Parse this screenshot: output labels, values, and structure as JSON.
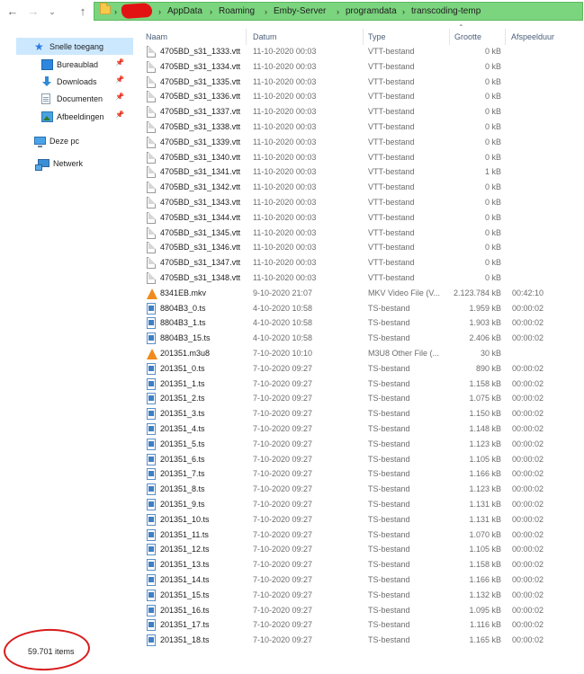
{
  "navigation": {
    "back_icon": "arrow-left",
    "forward_icon": "arrow-right",
    "recent_icon": "chevron-down",
    "up_icon": "arrow-up"
  },
  "address_bar": {
    "highlight_color": "#7bd47e",
    "redaction_color": "#e31212",
    "breadcrumbs": [
      "AppData",
      "Roaming",
      "Emby-Server",
      "programdata",
      "transcoding-temp"
    ]
  },
  "sidebar": {
    "quick_access": "Snelle toegang",
    "items": [
      {
        "label": "Bureaublad",
        "icon": "desktop-icon"
      },
      {
        "label": "Downloads",
        "icon": "download-icon"
      },
      {
        "label": "Documenten",
        "icon": "documents-icon"
      },
      {
        "label": "Afbeeldingen",
        "icon": "pictures-icon"
      }
    ],
    "this_pc": "Deze pc",
    "network": "Netwerk"
  },
  "columns": {
    "name": "Naam",
    "date": "Datum",
    "type": "Type",
    "size": "Grootte",
    "duration": "Afspeelduur"
  },
  "files": [
    {
      "name": "4705BD_s31_1333.vtt",
      "date": "11-10-2020 00:03",
      "type": "VTT-bestand",
      "size": "0 kB",
      "duration": "",
      "icon": "vtt"
    },
    {
      "name": "4705BD_s31_1334.vtt",
      "date": "11-10-2020 00:03",
      "type": "VTT-bestand",
      "size": "0 kB",
      "duration": "",
      "icon": "vtt"
    },
    {
      "name": "4705BD_s31_1335.vtt",
      "date": "11-10-2020 00:03",
      "type": "VTT-bestand",
      "size": "0 kB",
      "duration": "",
      "icon": "vtt"
    },
    {
      "name": "4705BD_s31_1336.vtt",
      "date": "11-10-2020 00:03",
      "type": "VTT-bestand",
      "size": "0 kB",
      "duration": "",
      "icon": "vtt"
    },
    {
      "name": "4705BD_s31_1337.vtt",
      "date": "11-10-2020 00:03",
      "type": "VTT-bestand",
      "size": "0 kB",
      "duration": "",
      "icon": "vtt"
    },
    {
      "name": "4705BD_s31_1338.vtt",
      "date": "11-10-2020 00:03",
      "type": "VTT-bestand",
      "size": "0 kB",
      "duration": "",
      "icon": "vtt"
    },
    {
      "name": "4705BD_s31_1339.vtt",
      "date": "11-10-2020 00:03",
      "type": "VTT-bestand",
      "size": "0 kB",
      "duration": "",
      "icon": "vtt"
    },
    {
      "name": "4705BD_s31_1340.vtt",
      "date": "11-10-2020 00:03",
      "type": "VTT-bestand",
      "size": "0 kB",
      "duration": "",
      "icon": "vtt"
    },
    {
      "name": "4705BD_s31_1341.vtt",
      "date": "11-10-2020 00:03",
      "type": "VTT-bestand",
      "size": "1 kB",
      "duration": "",
      "icon": "vtt"
    },
    {
      "name": "4705BD_s31_1342.vtt",
      "date": "11-10-2020 00:03",
      "type": "VTT-bestand",
      "size": "0 kB",
      "duration": "",
      "icon": "vtt"
    },
    {
      "name": "4705BD_s31_1343.vtt",
      "date": "11-10-2020 00:03",
      "type": "VTT-bestand",
      "size": "0 kB",
      "duration": "",
      "icon": "vtt"
    },
    {
      "name": "4705BD_s31_1344.vtt",
      "date": "11-10-2020 00:03",
      "type": "VTT-bestand",
      "size": "0 kB",
      "duration": "",
      "icon": "vtt"
    },
    {
      "name": "4705BD_s31_1345.vtt",
      "date": "11-10-2020 00:03",
      "type": "VTT-bestand",
      "size": "0 kB",
      "duration": "",
      "icon": "vtt"
    },
    {
      "name": "4705BD_s31_1346.vtt",
      "date": "11-10-2020 00:03",
      "type": "VTT-bestand",
      "size": "0 kB",
      "duration": "",
      "icon": "vtt"
    },
    {
      "name": "4705BD_s31_1347.vtt",
      "date": "11-10-2020 00:03",
      "type": "VTT-bestand",
      "size": "0 kB",
      "duration": "",
      "icon": "vtt"
    },
    {
      "name": "4705BD_s31_1348.vtt",
      "date": "11-10-2020 00:03",
      "type": "VTT-bestand",
      "size": "0 kB",
      "duration": "",
      "icon": "vtt"
    },
    {
      "name": "8341EB.mkv",
      "date": "9-10-2020 21:07",
      "type": "MKV Video File (V...",
      "size": "2.123.784 kB",
      "duration": "00:42:10",
      "icon": "vlc"
    },
    {
      "name": "8804B3_0.ts",
      "date": "4-10-2020 10:58",
      "type": "TS-bestand",
      "size": "1.959 kB",
      "duration": "00:00:02",
      "icon": "ts"
    },
    {
      "name": "8804B3_1.ts",
      "date": "4-10-2020 10:58",
      "type": "TS-bestand",
      "size": "1.903 kB",
      "duration": "00:00:02",
      "icon": "ts"
    },
    {
      "name": "8804B3_15.ts",
      "date": "4-10-2020 10:58",
      "type": "TS-bestand",
      "size": "2.406 kB",
      "duration": "00:00:02",
      "icon": "ts"
    },
    {
      "name": "201351.m3u8",
      "date": "7-10-2020 10:10",
      "type": "M3U8 Other File (...",
      "size": "30 kB",
      "duration": "",
      "icon": "vlc"
    },
    {
      "name": "201351_0.ts",
      "date": "7-10-2020 09:27",
      "type": "TS-bestand",
      "size": "890 kB",
      "duration": "00:00:02",
      "icon": "ts"
    },
    {
      "name": "201351_1.ts",
      "date": "7-10-2020 09:27",
      "type": "TS-bestand",
      "size": "1.158 kB",
      "duration": "00:00:02",
      "icon": "ts"
    },
    {
      "name": "201351_2.ts",
      "date": "7-10-2020 09:27",
      "type": "TS-bestand",
      "size": "1.075 kB",
      "duration": "00:00:02",
      "icon": "ts"
    },
    {
      "name": "201351_3.ts",
      "date": "7-10-2020 09:27",
      "type": "TS-bestand",
      "size": "1.150 kB",
      "duration": "00:00:02",
      "icon": "ts"
    },
    {
      "name": "201351_4.ts",
      "date": "7-10-2020 09:27",
      "type": "TS-bestand",
      "size": "1.148 kB",
      "duration": "00:00:02",
      "icon": "ts"
    },
    {
      "name": "201351_5.ts",
      "date": "7-10-2020 09:27",
      "type": "TS-bestand",
      "size": "1.123 kB",
      "duration": "00:00:02",
      "icon": "ts"
    },
    {
      "name": "201351_6.ts",
      "date": "7-10-2020 09:27",
      "type": "TS-bestand",
      "size": "1.105 kB",
      "duration": "00:00:02",
      "icon": "ts"
    },
    {
      "name": "201351_7.ts",
      "date": "7-10-2020 09:27",
      "type": "TS-bestand",
      "size": "1.166 kB",
      "duration": "00:00:02",
      "icon": "ts"
    },
    {
      "name": "201351_8.ts",
      "date": "7-10-2020 09:27",
      "type": "TS-bestand",
      "size": "1.123 kB",
      "duration": "00:00:02",
      "icon": "ts"
    },
    {
      "name": "201351_9.ts",
      "date": "7-10-2020 09:27",
      "type": "TS-bestand",
      "size": "1.131 kB",
      "duration": "00:00:02",
      "icon": "ts"
    },
    {
      "name": "201351_10.ts",
      "date": "7-10-2020 09:27",
      "type": "TS-bestand",
      "size": "1.131 kB",
      "duration": "00:00:02",
      "icon": "ts"
    },
    {
      "name": "201351_11.ts",
      "date": "7-10-2020 09:27",
      "type": "TS-bestand",
      "size": "1.070 kB",
      "duration": "00:00:02",
      "icon": "ts"
    },
    {
      "name": "201351_12.ts",
      "date": "7-10-2020 09:27",
      "type": "TS-bestand",
      "size": "1.105 kB",
      "duration": "00:00:02",
      "icon": "ts"
    },
    {
      "name": "201351_13.ts",
      "date": "7-10-2020 09:27",
      "type": "TS-bestand",
      "size": "1.158 kB",
      "duration": "00:00:02",
      "icon": "ts"
    },
    {
      "name": "201351_14.ts",
      "date": "7-10-2020 09:27",
      "type": "TS-bestand",
      "size": "1.166 kB",
      "duration": "00:00:02",
      "icon": "ts"
    },
    {
      "name": "201351_15.ts",
      "date": "7-10-2020 09:27",
      "type": "TS-bestand",
      "size": "1.132 kB",
      "duration": "00:00:02",
      "icon": "ts"
    },
    {
      "name": "201351_16.ts",
      "date": "7-10-2020 09:27",
      "type": "TS-bestand",
      "size": "1.095 kB",
      "duration": "00:00:02",
      "icon": "ts"
    },
    {
      "name": "201351_17.ts",
      "date": "7-10-2020 09:27",
      "type": "TS-bestand",
      "size": "1.116 kB",
      "duration": "00:00:02",
      "icon": "ts"
    },
    {
      "name": "201351_18.ts",
      "date": "7-10-2020 09:27",
      "type": "TS-bestand",
      "size": "1.165 kB",
      "duration": "00:00:02",
      "icon": "ts"
    }
  ],
  "status_bar": {
    "item_count": "59.701 items",
    "annotation_color": "#d81b1b"
  }
}
